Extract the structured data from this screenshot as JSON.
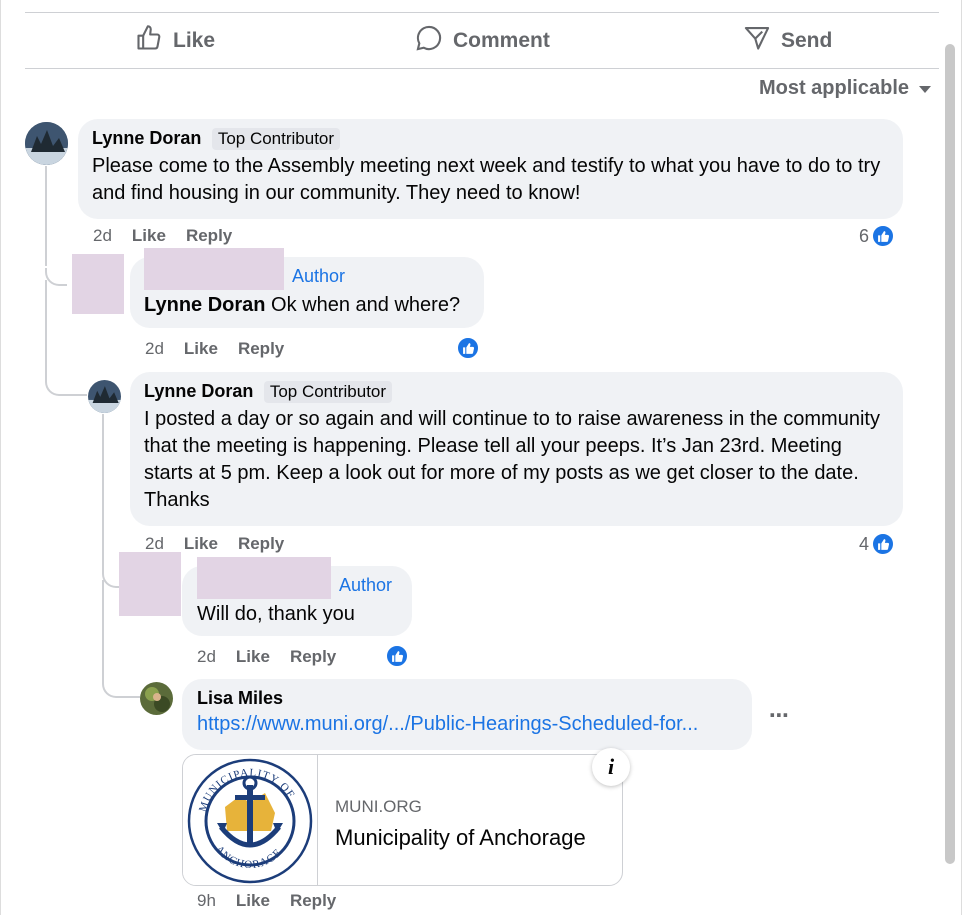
{
  "actions": {
    "like": "Like",
    "comment": "Comment",
    "send": "Send"
  },
  "sort": {
    "label": "Most applicable"
  },
  "comments": [
    {
      "name": "Lynne Doran",
      "badge": "Top Contributor",
      "text": "Please come to the Assembly meeting next week and testify to what you have to do to try and find housing in our community. They need to know!",
      "time": "2d",
      "like": "Like",
      "reply": "Reply",
      "reactions": "6"
    },
    {
      "author": "Author",
      "name": "Lynne Doran",
      "text": " Ok when and where?",
      "time": "2d",
      "like": "Like",
      "reply": "Reply"
    },
    {
      "name": "Lynne Doran",
      "badge": "Top Contributor",
      "text": "I posted a day or so again and will continue to to raise awareness in the community that the meeting is happening. Please tell all your peeps. It’s Jan 23rd. Meeting starts at 5 pm. Keep a look out for more of my posts as we get closer to the date. Thanks",
      "time": "2d",
      "like": "Like",
      "reply": "Reply",
      "reactions": "4"
    },
    {
      "author": "Author",
      "text": "Will do, thank you",
      "time": "2d",
      "like": "Like",
      "reply": "Reply"
    },
    {
      "name": "Lisa Miles",
      "link": "https://www.muni.org/.../Public-Hearings-Scheduled-for...",
      "card": {
        "domain": "MUNI.ORG",
        "title": "Municipality of Anchorage",
        "seal_top": "MUNICIPALITY OF",
        "seal_bottom": "ANCHORAGE"
      },
      "time": "9h",
      "like": "Like",
      "reply": "Reply"
    }
  ],
  "colors": {
    "accent": "#1b74e4",
    "bubble": "#f0f2f5",
    "muted": "#65676b",
    "redaction": "#e2d4e4"
  }
}
